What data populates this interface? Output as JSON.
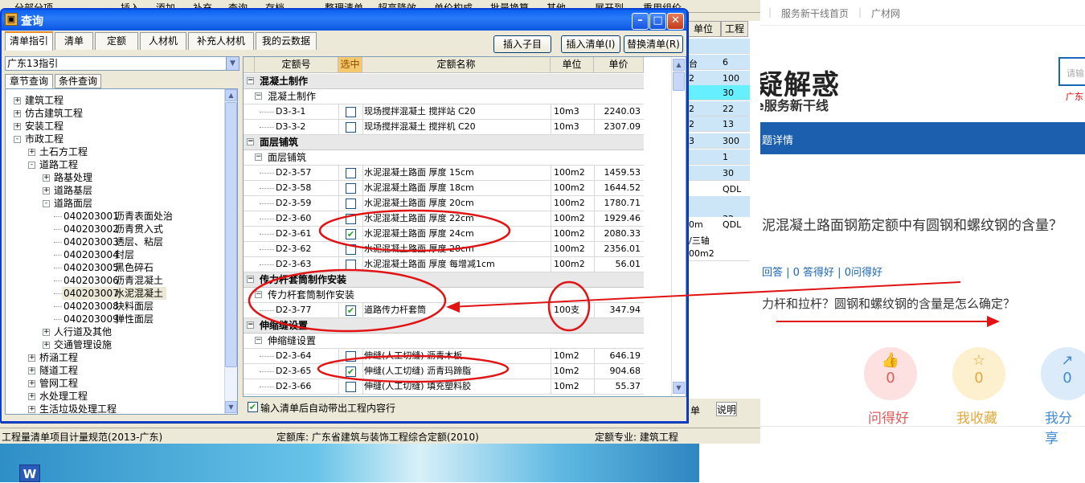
{
  "background_app": {
    "top_left_label": "分部分项",
    "top_menu": [
      "插入",
      "添加",
      "补充",
      "查询",
      "存档",
      "整理清单",
      "超高降效",
      "单价构成",
      "批量换算",
      "其他",
      "展开到",
      "重用组价"
    ],
    "right_table": {
      "headers": [
        "单位",
        "工程量"
      ],
      "rows": [
        {
          "unit": "",
          "qty": ""
        },
        {
          "unit": "台",
          "qty": "6"
        },
        {
          "unit": "2",
          "qty": "100"
        },
        {
          "unit": "",
          "qty": "30"
        },
        {
          "unit": "2",
          "qty": "22"
        },
        {
          "unit": "2",
          "qty": "13"
        },
        {
          "unit": "3",
          "qty": "300"
        },
        {
          "unit": "",
          "qty": "1"
        },
        {
          "unit": "",
          "qty": "30"
        },
        {
          "unit": "",
          "qty": "QDL"
        },
        {
          "unit": "",
          "qty": "32"
        },
        {
          "unit": "0m",
          "qty": "QDL"
        },
        {
          "unit": "/三轴",
          "qty": ""
        },
        {
          "unit": "00m2",
          "qty": ""
        }
      ],
      "bottom_tab_1": "单",
      "bottom_tab_2": "说明"
    },
    "status_bar": {
      "left": "工程量清单项目计量规范(2013-广东)",
      "middle": "定额库: 广东省建筑与装饰工程综合定额(2010)",
      "right": "定额专业: 建筑工程"
    }
  },
  "desktop": {
    "word_icon_letter": "W"
  },
  "dialog": {
    "title": "查询",
    "tabs": [
      "清单指引",
      "清单",
      "定额",
      "人材机",
      "补充人材机",
      "我的云数据"
    ],
    "actions": {
      "insert_child": "插入子目",
      "insert_list": "插入清单(I)",
      "replace_list": "替换清单(R)"
    },
    "combo_value": "广东13指引",
    "subtabs": [
      "章节查询",
      "条件查询"
    ],
    "tree": [
      {
        "label": "建筑工程",
        "level": 0,
        "exp": "+"
      },
      {
        "label": "仿古建筑工程",
        "level": 0,
        "exp": "+"
      },
      {
        "label": "安装工程",
        "level": 0,
        "exp": "+"
      },
      {
        "label": "市政工程",
        "level": 0,
        "exp": "-"
      },
      {
        "label": "土石方工程",
        "level": 1,
        "exp": "+"
      },
      {
        "label": "道路工程",
        "level": 1,
        "exp": "-"
      },
      {
        "label": "路基处理",
        "level": 2,
        "exp": "+"
      },
      {
        "label": "道路基层",
        "level": 2,
        "exp": "+"
      },
      {
        "label": "道路面层",
        "level": 2,
        "exp": "-"
      },
      {
        "code": "040203001",
        "label": "沥青表面处治",
        "level": 3
      },
      {
        "code": "040203002",
        "label": "沥青贯入式",
        "level": 3
      },
      {
        "code": "040203003",
        "label": "透层、粘层",
        "level": 3
      },
      {
        "code": "040203004",
        "label": "封层",
        "level": 3
      },
      {
        "code": "040203005",
        "label": "黑色碎石",
        "level": 3
      },
      {
        "code": "040203006",
        "label": "沥青混凝土",
        "level": 3
      },
      {
        "code": "040203007",
        "label": "水泥混凝土",
        "level": 3,
        "selected": true
      },
      {
        "code": "040203008",
        "label": "块料面层",
        "level": 3
      },
      {
        "code": "040203009",
        "label": "弹性面层",
        "level": 3
      },
      {
        "label": "人行道及其他",
        "level": 2,
        "exp": "+"
      },
      {
        "label": "交通管理设施",
        "level": 2,
        "exp": "+"
      },
      {
        "label": "桥涵工程",
        "level": 1,
        "exp": "+"
      },
      {
        "label": "隧道工程",
        "level": 1,
        "exp": "+"
      },
      {
        "label": "管网工程",
        "level": 1,
        "exp": "+"
      },
      {
        "label": "水处理工程",
        "level": 1,
        "exp": "+"
      },
      {
        "label": "生活垃圾处理工程",
        "level": 1,
        "exp": "+"
      }
    ],
    "grid_headers": {
      "code": "定额号",
      "check": "选中",
      "name": "定额名称",
      "unit": "单位",
      "price": "单价"
    },
    "grid_rows": [
      {
        "kind": "sec",
        "label": "混凝土制作"
      },
      {
        "kind": "sub",
        "label": "混凝土制作"
      },
      {
        "kind": "row",
        "code": "D3-3-1",
        "checked": false,
        "name": "现场搅拌混凝土 搅拌站 C20",
        "unit": "10m3",
        "price": "2240.03"
      },
      {
        "kind": "row",
        "code": "D3-3-2",
        "checked": false,
        "name": "现场搅拌混凝土 搅拌机 C20",
        "unit": "10m3",
        "price": "2307.09"
      },
      {
        "kind": "sec",
        "label": "面层铺筑"
      },
      {
        "kind": "sub",
        "label": "面层铺筑"
      },
      {
        "kind": "row",
        "code": "D2-3-57",
        "checked": false,
        "name": "水泥混凝土路面 厚度 15cm",
        "unit": "100m2",
        "price": "1459.53"
      },
      {
        "kind": "row",
        "code": "D2-3-58",
        "checked": false,
        "name": "水泥混凝土路面 厚度 18cm",
        "unit": "100m2",
        "price": "1644.52"
      },
      {
        "kind": "row",
        "code": "D2-3-59",
        "checked": false,
        "name": "水泥混凝土路面 厚度 20cm",
        "unit": "100m2",
        "price": "1780.71"
      },
      {
        "kind": "row",
        "code": "D2-3-60",
        "checked": false,
        "name": "水泥混凝土路面 厚度 22cm",
        "unit": "100m2",
        "price": "1929.46"
      },
      {
        "kind": "row",
        "code": "D2-3-61",
        "checked": true,
        "name": "水泥混凝土路面 厚度 24cm",
        "unit": "100m2",
        "price": "2080.33"
      },
      {
        "kind": "row",
        "code": "D2-3-62",
        "checked": false,
        "name": "水泥混凝土路面 厚度 28cm",
        "unit": "100m2",
        "price": "2356.01"
      },
      {
        "kind": "row",
        "code": "D2-3-63",
        "checked": false,
        "name": "水泥混凝土路面 厚度 每增减1cm",
        "unit": "100m2",
        "price": "56.01"
      },
      {
        "kind": "sec",
        "label": "传力杆套筒制作安装"
      },
      {
        "kind": "sub",
        "label": "传力杆套筒制作安装"
      },
      {
        "kind": "row",
        "code": "D2-3-77",
        "checked": true,
        "name": "道路传力杆套筒",
        "unit": "100支",
        "price": "347.94"
      },
      {
        "kind": "sec",
        "label": "伸缩缝设置"
      },
      {
        "kind": "sub",
        "label": "伸缩缝设置"
      },
      {
        "kind": "row",
        "code": "D2-3-64",
        "checked": false,
        "name": "伸缝(人工切缝) 沥青木板",
        "unit": "10m2",
        "price": "646.19"
      },
      {
        "kind": "row",
        "code": "D2-3-65",
        "checked": true,
        "name": "伸缝(人工切缝) 沥青玛蹄脂",
        "unit": "10m2",
        "price": "904.68"
      },
      {
        "kind": "row",
        "code": "D2-3-66",
        "checked": false,
        "name": "伸缝(人工切缝) 填充塑料胶",
        "unit": "10m2",
        "price": "55.37"
      }
    ],
    "auto_bring_label": "输入清单后自动带出工程内容行"
  },
  "web": {
    "top_links": [
      "服务新干线首页",
      "广材网"
    ],
    "big_title": "疑解惑",
    "sub_title": "e服务新干线",
    "search_placeholder": "请输",
    "region": "广东",
    "nav_text": "题详情",
    "question": "泥混凝土路面钢筋定额中有圆钢和螺纹钢的含量？",
    "stats": "回答 | 0 答得好 | 0问得好",
    "answer": "力杆和拉杆？圆钢和螺纹钢的含量是怎么确定？",
    "actions": [
      {
        "label": "问得好",
        "count": "0",
        "icon": "thumbs-up-icon",
        "glyph": "👍"
      },
      {
        "label": "我收藏",
        "count": "0",
        "icon": "star-icon",
        "glyph": "☆"
      },
      {
        "label": "我分享",
        "count": "0",
        "icon": "share-icon",
        "glyph": "↗"
      }
    ]
  },
  "colors": {
    "annotation_red": "#e01414",
    "title_blue": "#0a5ff0",
    "web_blue": "#1c5fae"
  }
}
